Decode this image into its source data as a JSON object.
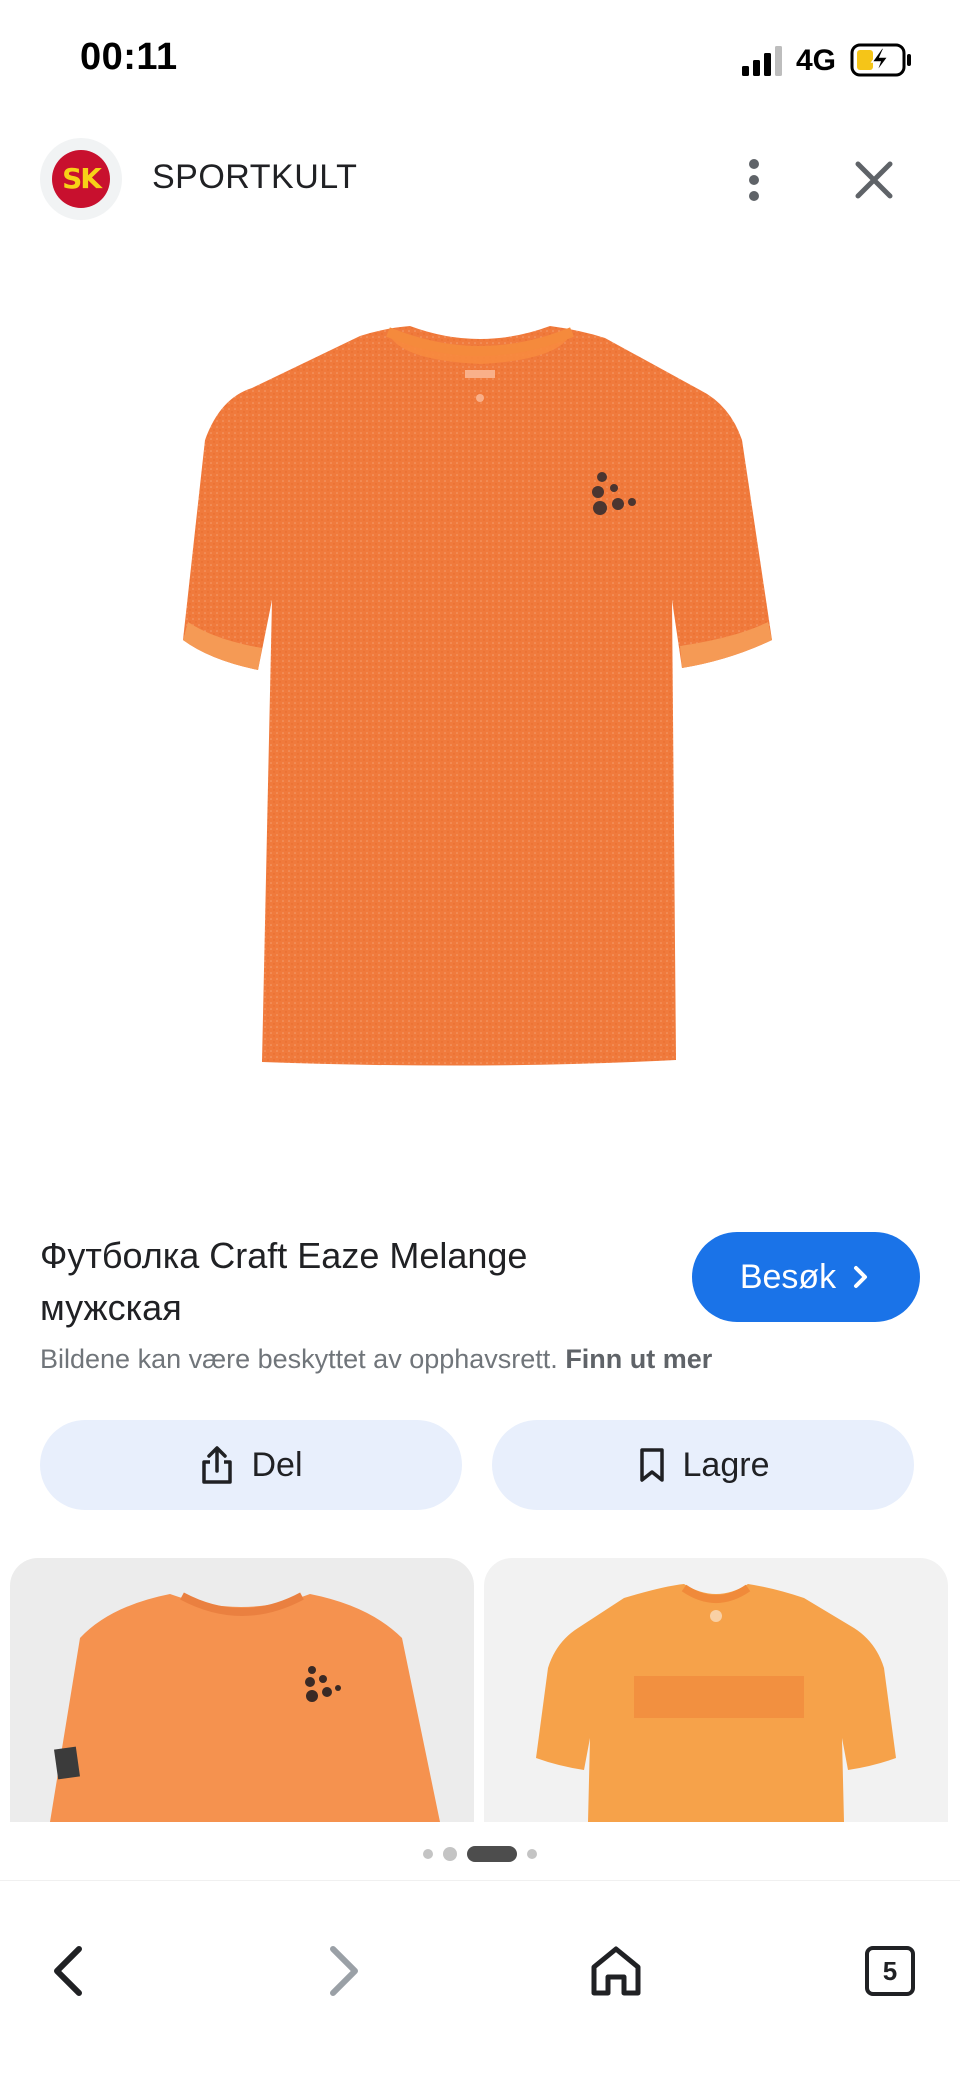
{
  "status_bar": {
    "time": "00:11",
    "network": "4G",
    "icons": [
      "signal-icon",
      "battery-charging-icon"
    ]
  },
  "header": {
    "site_name": "SPORTKULT",
    "logo_text": "SK",
    "logo_color": "#c8102e",
    "logo_text_color": "#f7d117",
    "icons": [
      "more-vertical-icon",
      "close-icon"
    ]
  },
  "main_image": {
    "description_icon": "orange-t-shirt-image",
    "shirt_color": "#f07a3c"
  },
  "product": {
    "title": "Футболка Craft Eaze Melange мужская",
    "visit_label": "Besøk",
    "copyright_text": "Bildene kan være beskyttet av opphavsrett.",
    "copyright_link": "Finn ut mer"
  },
  "actions": {
    "share_label": "Del",
    "save_label": "Lagre"
  },
  "related": {
    "thumbnails": [
      "orange-t-shirt-thumbnail",
      "orange-t-shirt-thumbnail"
    ]
  },
  "pager": {
    "active_index": 2,
    "count": 4
  },
  "bottom_nav": {
    "tab_count": "5",
    "icons": [
      "back-icon",
      "forward-icon",
      "home-icon",
      "tabs-icon"
    ]
  },
  "colors": {
    "accent": "#1a73e8",
    "action_bg": "#e8effc",
    "secondary_text": "#70757a"
  }
}
